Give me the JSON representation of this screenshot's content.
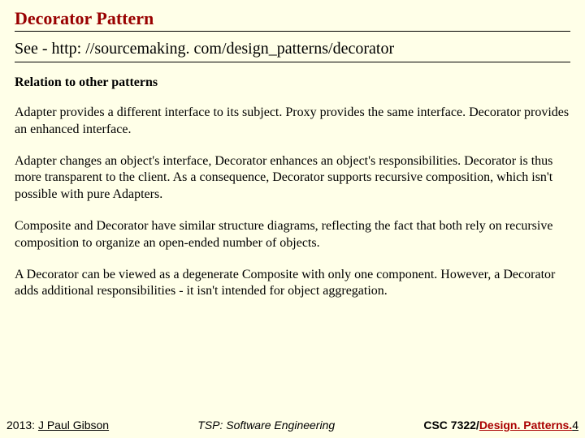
{
  "title": "Decorator Pattern",
  "see": {
    "prefix": "See -  ",
    "url": "http: //sourcemaking. com/design_patterns/decorator"
  },
  "section_heading": "Relation to other patterns",
  "paras": {
    "p1": "Adapter provides a different interface to its subject. Proxy provides the same interface. Decorator provides an enhanced interface.",
    "p2": "Adapter changes an object's interface, Decorator enhances an object's responsibilities. Decorator is thus more transparent to the client. As a consequence, Decorator supports recursive composition, which isn't possible with pure Adapters.",
    "p3": "Composite and Decorator have similar structure diagrams, reflecting the fact that both rely on recursive composition to organize an open-ended number of objects.",
    "p4": "A Decorator can be viewed as a degenerate Composite with only one component. However, a Decorator adds additional responsibilities - it isn't intended for object aggregation."
  },
  "footer": {
    "year": "2013: ",
    "author": "J Paul Gibson",
    "center": "TSP: Software Engineering",
    "course": "CSC 7322/",
    "topic": "Design. Patterns.",
    "page": "4"
  }
}
